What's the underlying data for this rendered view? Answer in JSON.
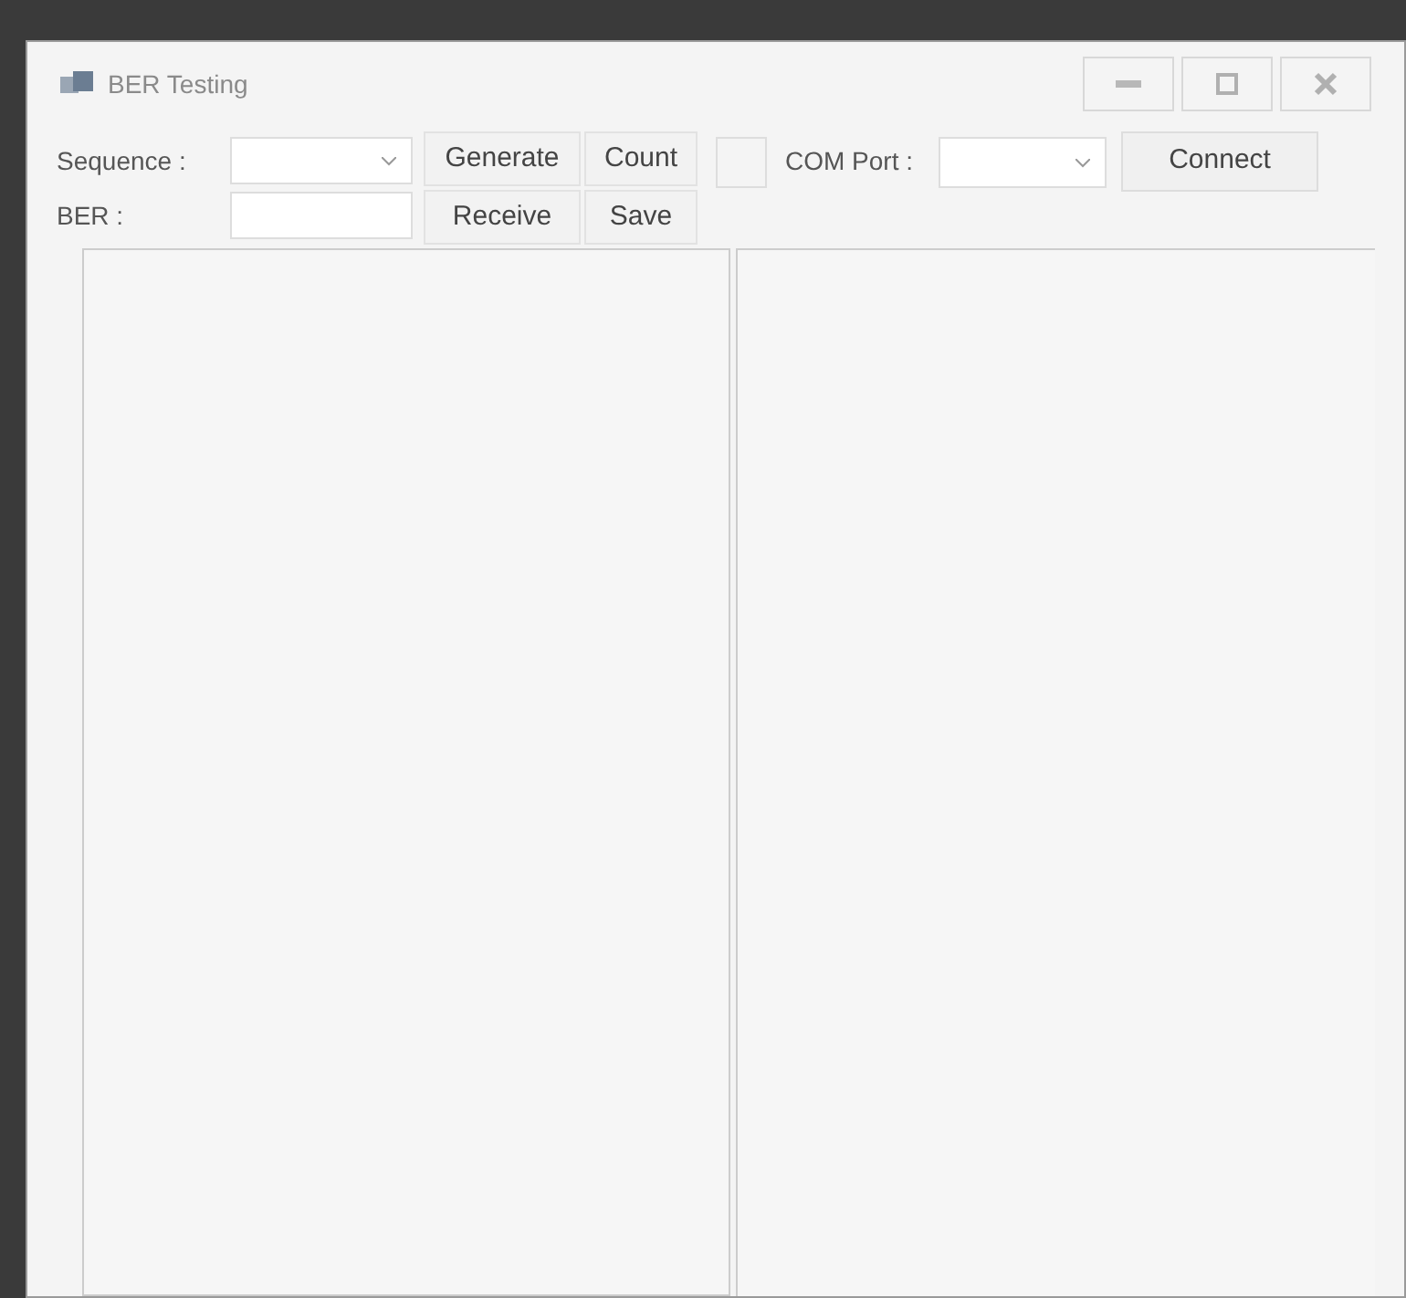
{
  "window": {
    "title": "BER Testing"
  },
  "controls": {
    "sequence_label": "Sequence :",
    "ber_label": "BER :",
    "com_port_label": "COM Port :",
    "buttons": [
      {
        "label": "Generate"
      },
      {
        "label": "Count"
      },
      {
        "label": "Receive"
      },
      {
        "label": "Save"
      }
    ],
    "connect_button": "Connect"
  }
}
